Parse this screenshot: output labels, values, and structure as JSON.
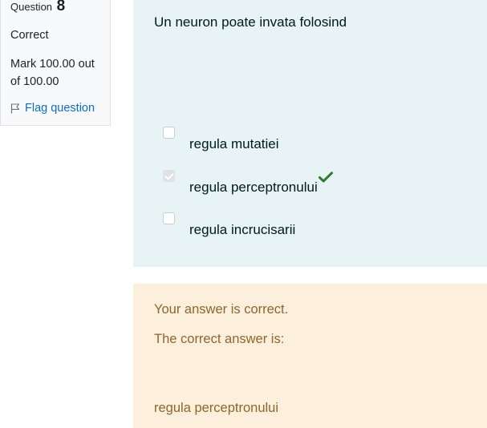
{
  "info": {
    "question_label": "Question",
    "question_number": "8",
    "state": "Correct",
    "grade": "Mark 100.00 out of 100.00",
    "flag_label": "Flag question"
  },
  "question": {
    "text": "Un neuron poate invata folosind",
    "options": [
      {
        "label": "regula mutatiei",
        "checked": false,
        "correct": false
      },
      {
        "label": "regula perceptronului",
        "checked": true,
        "correct": true
      },
      {
        "label": "regula incrucisarii",
        "checked": false,
        "correct": false
      }
    ]
  },
  "feedback": {
    "result": "Your answer is correct.",
    "correct_answer_label": "The correct answer is:",
    "correct_answer": "regula perceptronului"
  },
  "colors": {
    "correct_tick": "#357a32",
    "formulation_bg": "#e7f3f5",
    "feedback_bg": "#fcefdc",
    "feedback_text": "#8e662e",
    "link": "#0f6cbf"
  }
}
